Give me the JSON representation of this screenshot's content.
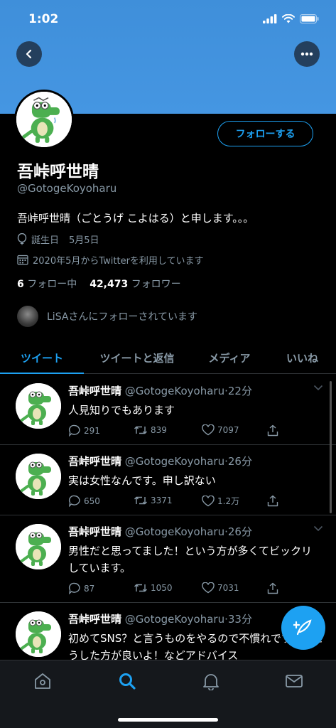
{
  "status": {
    "time": "1:02"
  },
  "profile": {
    "name": "吾峠呼世晴",
    "handle": "@GotogeKoyoharu",
    "follow_button": "フォローする",
    "bio": "吾峠呼世晴（ごとうげ こよはる）と申します。。。",
    "birthday_label": "誕生日",
    "birthday": "5月5日",
    "joined": "2020年5月からTwitterを利用しています",
    "following_count": "6",
    "following_label": "フォロー中",
    "followers_count": "42,473",
    "followers_label": "フォロワー",
    "followed_by": "LiSAさんにフォローされています"
  },
  "tabs": [
    {
      "label": "ツイート"
    },
    {
      "label": "ツイートと返信"
    },
    {
      "label": "メディア"
    },
    {
      "label": "いいね"
    }
  ],
  "tweets": [
    {
      "name": "吾峠呼世晴",
      "handle": "@GotogeKoyoharu",
      "time": "·22分",
      "text": "人見知りでもあります",
      "replies": "291",
      "retweets": "839",
      "likes": "7097"
    },
    {
      "name": "吾峠呼世晴",
      "handle": "@GotogeKoyoharu",
      "time": "·26分",
      "text": "実は女性なんです。申し訳ない",
      "replies": "650",
      "retweets": "3371",
      "likes": "1.2万"
    },
    {
      "name": "吾峠呼世晴",
      "handle": "@GotogeKoyoharu",
      "time": "·26分",
      "text": "男性だと思ってました！という方が多くてビックリしています。",
      "replies": "87",
      "retweets": "1050",
      "likes": "7031"
    },
    {
      "name": "吾峠呼世晴",
      "handle": "@GotogeKoyoharu",
      "time": "·33分",
      "text": "初めてSNS？と言うものをやるので不慣れですが、こうした方が良いよ！などアドバイス"
    }
  ],
  "icons": {
    "back": "chevron-left-icon",
    "more": "more-icon",
    "balloon": "balloon-icon",
    "calendar": "calendar-icon",
    "reply": "reply-icon",
    "retweet": "retweet-icon",
    "like": "heart-icon",
    "share": "share-icon",
    "compose": "compose-icon",
    "home": "home-icon",
    "search": "search-icon",
    "notifications": "bell-icon",
    "messages": "mail-icon"
  },
  "colors": {
    "accent": "#1da1f2",
    "banner": "#4596e2",
    "muted": "#8899a6",
    "background": "#000000"
  }
}
